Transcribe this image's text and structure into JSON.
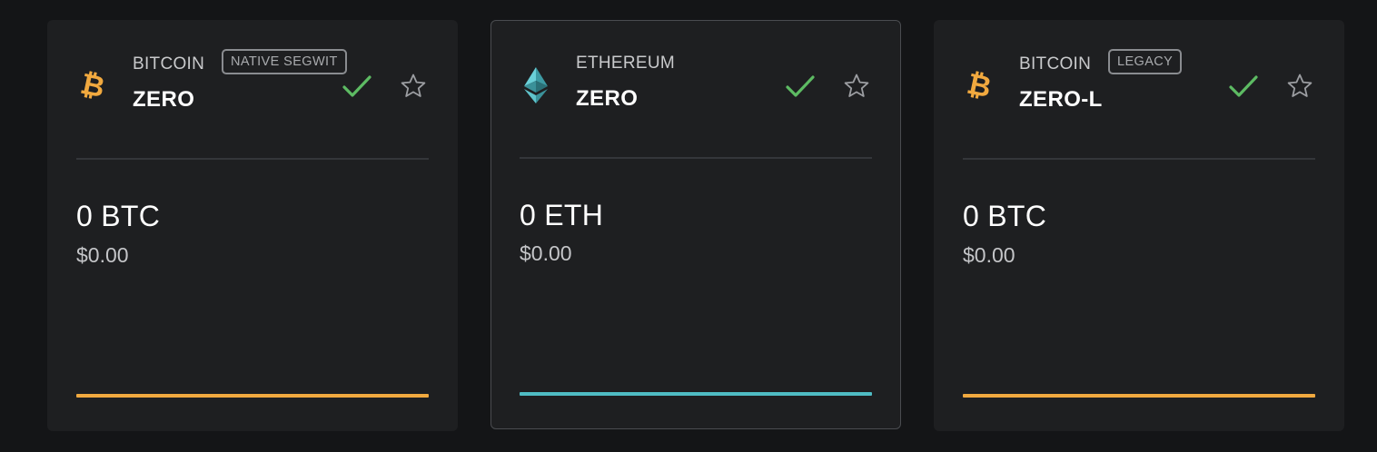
{
  "colors": {
    "bitcoin_accent": "#f1a93f",
    "ethereum_accent": "#4fbcc4",
    "check_green": "#5dbb63",
    "card_background": "#1e1f21",
    "page_background": "#141517"
  },
  "cards": [
    {
      "family": "BITCOIN",
      "tag": "NATIVE SEGWIT",
      "name": "ZERO",
      "balance": "0 BTC",
      "fiat": "$0.00",
      "icon": "bitcoin-icon",
      "selected": false,
      "accent": "#f1a93f"
    },
    {
      "family": "ETHEREUM",
      "tag": "",
      "name": "ZERO",
      "balance": "0 ETH",
      "fiat": "$0.00",
      "icon": "ethereum-icon",
      "selected": true,
      "accent": "#4fbcc4"
    },
    {
      "family": "BITCOIN",
      "tag": "LEGACY",
      "name": "ZERO-L",
      "balance": "0 BTC",
      "fiat": "$0.00",
      "icon": "bitcoin-icon",
      "selected": false,
      "accent": "#f1a93f"
    }
  ]
}
